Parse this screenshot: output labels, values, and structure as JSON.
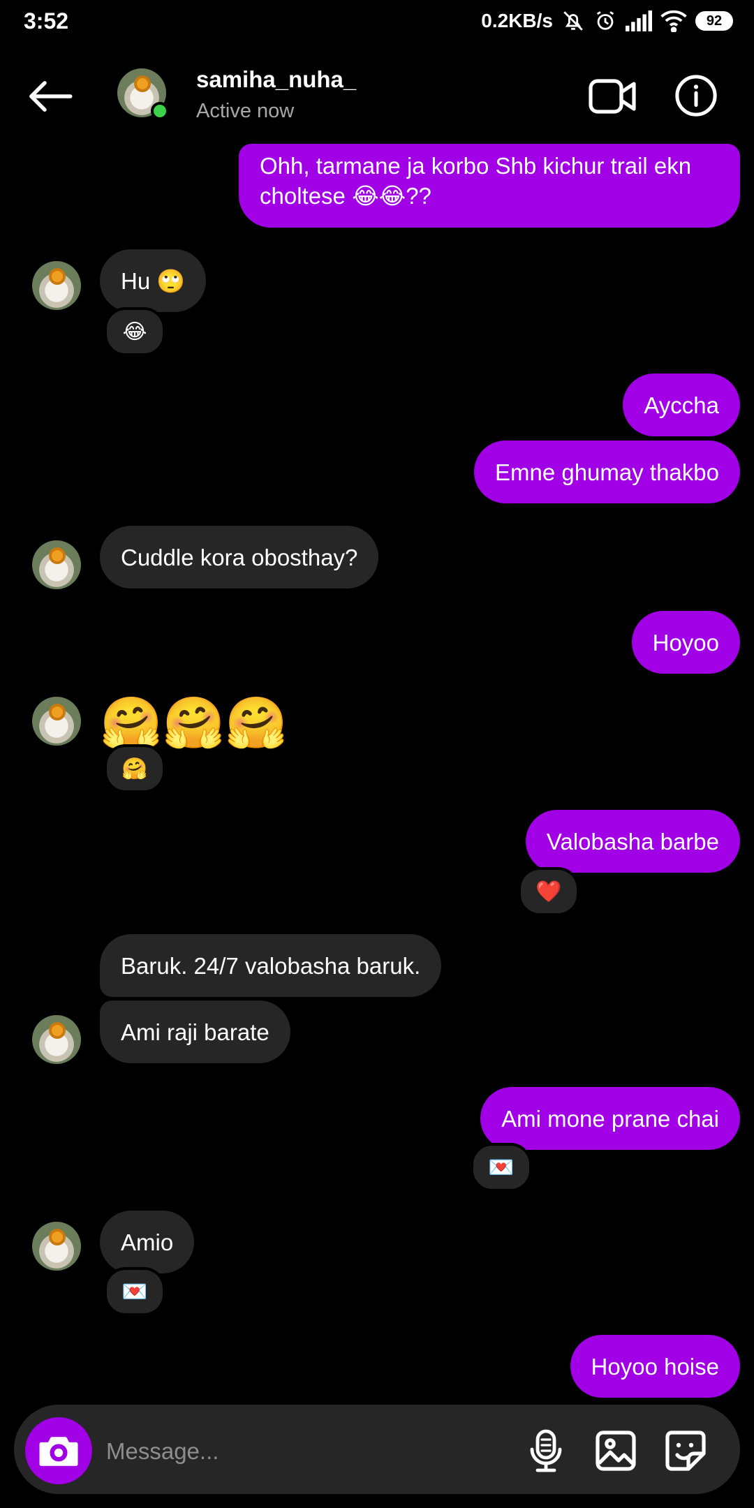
{
  "status_bar": {
    "time": "3:52",
    "network_speed": "0.2KB/s",
    "battery": "92"
  },
  "header": {
    "username": "samiha_nuha_",
    "status": "Active now"
  },
  "messages": [
    {
      "side": "out",
      "text": "Ohh, tarmane ja korbo Shb kichur trail ekn"
    },
    {
      "side": "out",
      "text": "choltese 😂😂??"
    },
    {
      "side": "in",
      "text": "Hu 🙄",
      "reaction": "😂"
    },
    {
      "side": "out",
      "text": "Ayccha"
    },
    {
      "side": "out",
      "text": "Emne ghumay thakbo"
    },
    {
      "side": "in",
      "text": "Cuddle kora obosthay?"
    },
    {
      "side": "out",
      "text": "Hoyoo"
    },
    {
      "side": "in",
      "text": "🤗🤗🤗",
      "reaction": "🤗"
    },
    {
      "side": "out",
      "text": "Valobasha barbe",
      "reaction": "❤️"
    },
    {
      "side": "in",
      "text": "Baruk. 24/7 valobasha baruk."
    },
    {
      "side": "in",
      "text": "Ami raji barate"
    },
    {
      "side": "out",
      "text": "Ami mone prane chai",
      "reaction": "💌"
    },
    {
      "side": "in",
      "text": "Amio",
      "reaction": "💌"
    },
    {
      "side": "out",
      "text": "Hoyoo hoise"
    }
  ],
  "composer": {
    "placeholder": "Message..."
  },
  "colors": {
    "outgoing_bubble": "#a100e6",
    "incoming_bubble": "#262626",
    "background": "#000000",
    "online": "#3bd14a"
  },
  "icons": [
    "back-arrow-icon",
    "video-camera-icon",
    "info-icon",
    "camera-icon",
    "microphone-icon",
    "gallery-icon",
    "sticker-icon"
  ]
}
